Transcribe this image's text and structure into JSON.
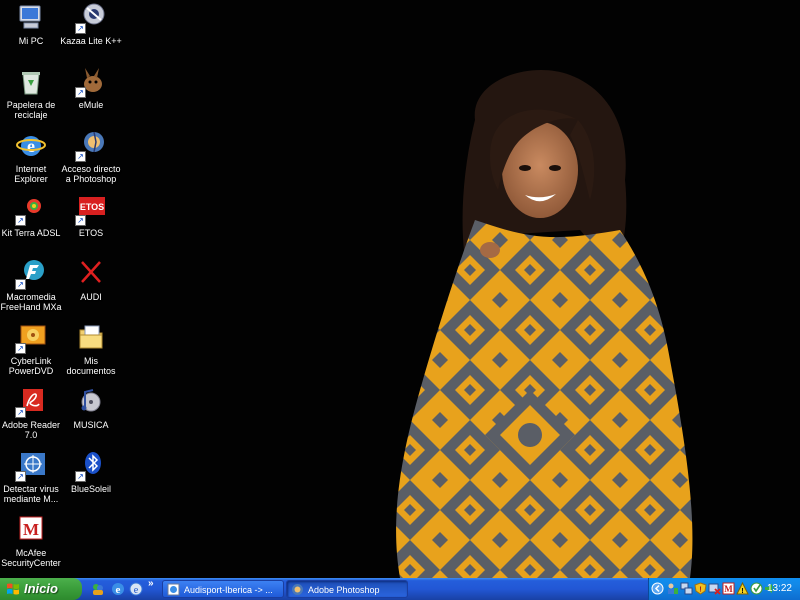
{
  "desktop": {
    "icons": [
      {
        "label": "Mi PC",
        "icon": "my-computer-icon"
      },
      {
        "label": "Kazaa Lite K++",
        "icon": "kazaa-icon"
      },
      {
        "label": "Papelera de reciclaje",
        "icon": "recycle-bin-icon"
      },
      {
        "label": "eMule",
        "icon": "emule-icon"
      },
      {
        "label": "Internet Explorer",
        "icon": "internet-explorer-icon"
      },
      {
        "label": "Acceso directo a Photoshop",
        "icon": "photoshop-icon"
      },
      {
        "label": "Kit Terra ADSL",
        "icon": "terra-icon"
      },
      {
        "label": "ETOS",
        "icon": "etos-icon"
      },
      {
        "label": "Macromedia FreeHand MXa",
        "icon": "freehand-icon"
      },
      {
        "label": "AUDI",
        "icon": "audi-x-icon"
      },
      {
        "label": "CyberLink PowerDVD",
        "icon": "powerdvd-icon"
      },
      {
        "label": "Mis documentos",
        "icon": "my-documents-icon"
      },
      {
        "label": "Adobe Reader 7.0",
        "icon": "adobe-reader-icon"
      },
      {
        "label": "MUSICA",
        "icon": "music-folder-icon"
      },
      {
        "label": "Detectar virus mediante M...",
        "icon": "virus-scan-icon"
      },
      {
        "label": "BlueSoleil",
        "icon": "bluetooth-icon"
      },
      {
        "label": "McAfee SecurityCenter",
        "icon": "mcafee-icon"
      }
    ]
  },
  "taskbar": {
    "start_label": "Inicio",
    "quick_launch_more": "»",
    "tasks": [
      {
        "label": "Audisport-Iberica -> ...",
        "icon": "ie-page-icon",
        "active": false
      },
      {
        "label": "Adobe Photoshop",
        "icon": "photoshop-task-icon",
        "active": true
      }
    ],
    "tray_expand": "‹",
    "clock": "13:22"
  },
  "colors": {
    "taskbar_blue": "#245edb",
    "start_green": "#3c9f3c",
    "tray_blue": "#0f8ef0",
    "blanket_yellow": "#e8a21c",
    "blanket_gray": "#5a5e66"
  }
}
